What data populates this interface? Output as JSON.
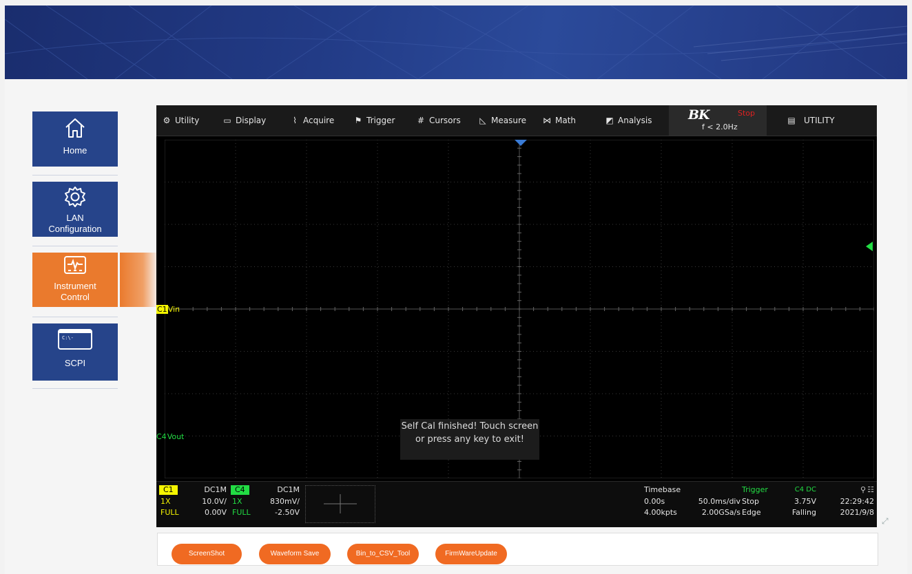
{
  "sidebar": {
    "items": [
      {
        "label": "Home",
        "icon": "home-icon"
      },
      {
        "label_line1": "LAN",
        "label_line2": "Configuration",
        "icon": "gear-icon"
      },
      {
        "label_line1": "Instrument",
        "label_line2": "Control",
        "icon": "monitor-waveform-icon",
        "active": true
      },
      {
        "label": "SCPI",
        "icon": "terminal-icon",
        "terminal_text": "C:\\-"
      }
    ]
  },
  "scope": {
    "menu": [
      "Utility",
      "Display",
      "Acquire",
      "Trigger",
      "Cursors",
      "Measure",
      "Math",
      "Analysis"
    ],
    "brand": "BK",
    "run_state": "Stop",
    "frequency": "f < 2.0Hz",
    "panel_title": "UTILITY",
    "ch1_marker": "C1",
    "ch1_label": "Vin",
    "ch4_marker": "C4",
    "ch4_label": "Vout",
    "toast": "Self Cal finished! Touch screen or press any key to exit!",
    "channels": [
      {
        "name": "C1",
        "coupling": "DC1M",
        "probe": "1X",
        "scale": "10.0V/",
        "bw": "FULL",
        "offset": "0.00V",
        "color": "#f5f500"
      },
      {
        "name": "C4",
        "coupling": "DC1M",
        "probe": "1X",
        "scale": "830mV/",
        "bw": "FULL",
        "offset": "-2.50V",
        "color": "#22dd44"
      }
    ],
    "timebase": {
      "title": "Timebase",
      "delay": "0.00s",
      "scale": "50.0ms/div",
      "points": "4.00kpts",
      "rate": "2.00GSa/s"
    },
    "trigger": {
      "title": "Trigger",
      "source": "C4 DC",
      "state": "Stop",
      "level": "3.75V",
      "type": "Edge",
      "slope": "Falling"
    },
    "clock": {
      "time": "22:29:42",
      "date": "2021/9/8"
    }
  },
  "buttons": [
    "ScreenShot",
    "Waveform Save",
    "Bin_to_CSV_Tool",
    "FirmWareUpdate"
  ],
  "colors": {
    "sidebar": "#26448a",
    "active": "#ea7a2d",
    "button": "#f06a22",
    "ch1": "#f5f500",
    "ch4": "#22dd44",
    "trigger_marker": "#22dd44",
    "time_marker": "#3a7bd5"
  }
}
